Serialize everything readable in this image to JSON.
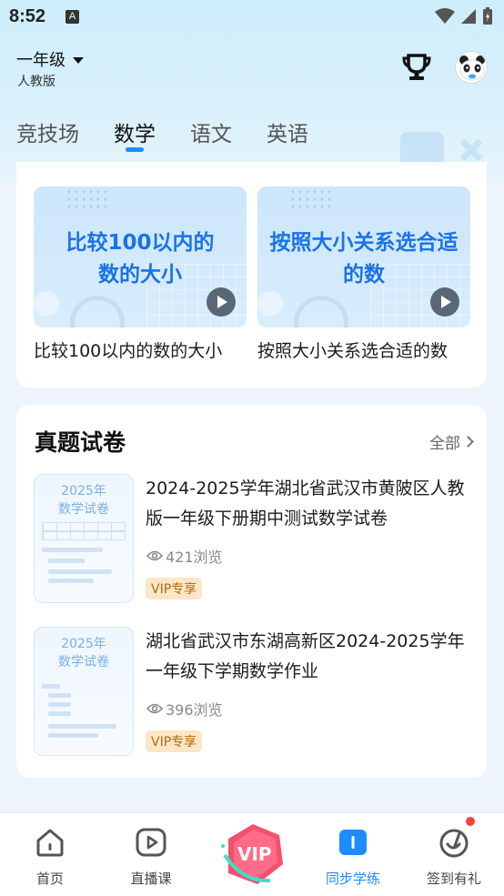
{
  "status": {
    "time": "8:52",
    "a_icon": "A"
  },
  "header": {
    "grade": "一年级",
    "edition": "人教版",
    "trophy_icon": "trophy-icon",
    "avatar_icon": "panda-avatar"
  },
  "tabs": [
    {
      "label": "竞技场"
    },
    {
      "label": "数学"
    },
    {
      "label": "语文"
    },
    {
      "label": "英语"
    }
  ],
  "videos": [
    {
      "cover_title": "比较100以内的数的大小",
      "caption": "比较100以内的数的大小"
    },
    {
      "cover_title": "按照大小关系选合适的数",
      "caption": "按照大小关系选合适的数"
    }
  ],
  "papers_section": {
    "title": "真题试卷",
    "all_label": "全部",
    "items": [
      {
        "cover_year": "2025年",
        "cover_subject": "数学试卷",
        "title": "2024-2025学年湖北省武汉市黄陂区人教版一年级下册期中测试数学试卷",
        "views": "421浏览",
        "tag": "VIP专享"
      },
      {
        "cover_year": "2025年",
        "cover_subject": "数学试卷",
        "title": "湖北省武汉市东湖高新区2024-2025学年一年级下学期数学作业",
        "views": "396浏览",
        "tag": "VIP专享"
      }
    ]
  },
  "bottom_nav": [
    {
      "label": "首页",
      "icon": "home-icon"
    },
    {
      "label": "直播课",
      "icon": "live-play-icon"
    },
    {
      "label": "VIP",
      "icon": "vip-icon"
    },
    {
      "label": "同步学练",
      "icon": "book-icon",
      "active": true
    },
    {
      "label": "签到有礼",
      "icon": "checkin-icon"
    }
  ],
  "colors": {
    "accent": "#1e8bff",
    "vip_tag_bg": "#fde6c5",
    "vip_tag_text": "#b06a12"
  }
}
